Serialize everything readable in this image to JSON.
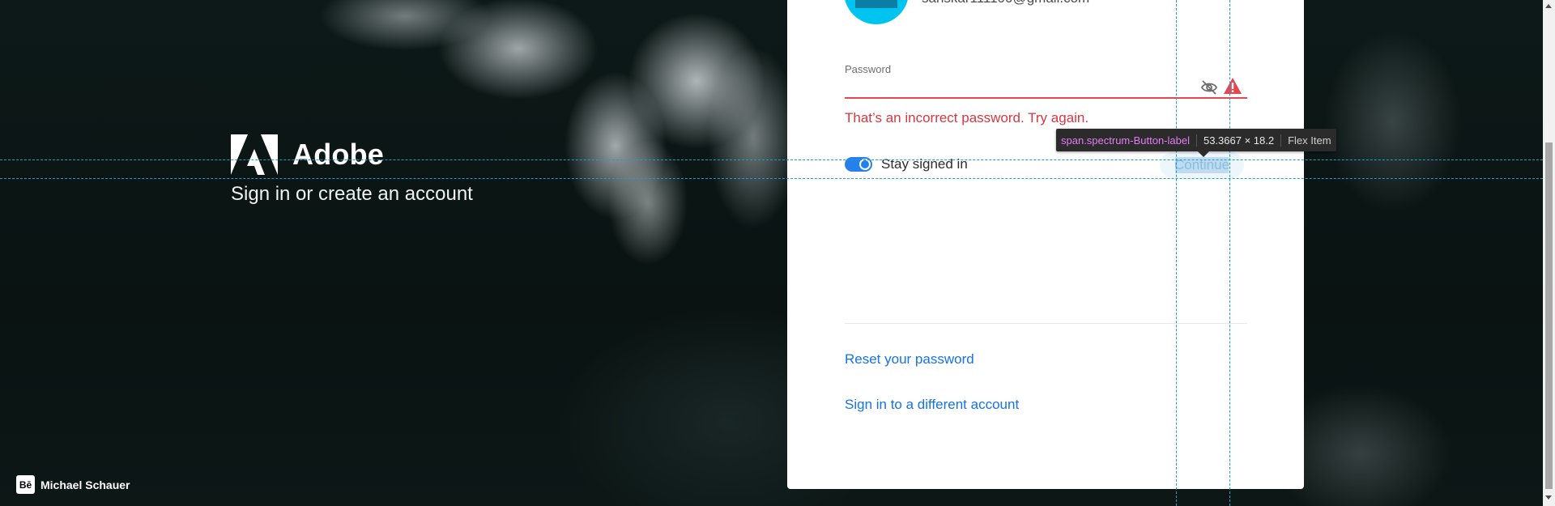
{
  "brand": {
    "name": "Adobe",
    "subtitle": "Sign in or create an account"
  },
  "credit": {
    "icon_text": "Bē",
    "author": "Michael Schauer"
  },
  "account": {
    "email": "sanskar111100@gmail.com"
  },
  "password": {
    "label": "Password",
    "value": "",
    "error": "That’s an incorrect password. Try again."
  },
  "stay_signed_in": {
    "label": "Stay signed in",
    "checked": true
  },
  "continue_button": {
    "label": "Continue"
  },
  "links": {
    "reset": "Reset your password",
    "different_account": "Sign in to a different account"
  },
  "devtools_tooltip": {
    "selector": "span.spectrum-Button-label",
    "dimensions": "53.3667 × 18.2",
    "type": "Flex Item"
  },
  "colors": {
    "accent": "#1473e6",
    "error": "#d7373f",
    "toggle": "#2680eb",
    "avatar": "#00c4f0"
  }
}
